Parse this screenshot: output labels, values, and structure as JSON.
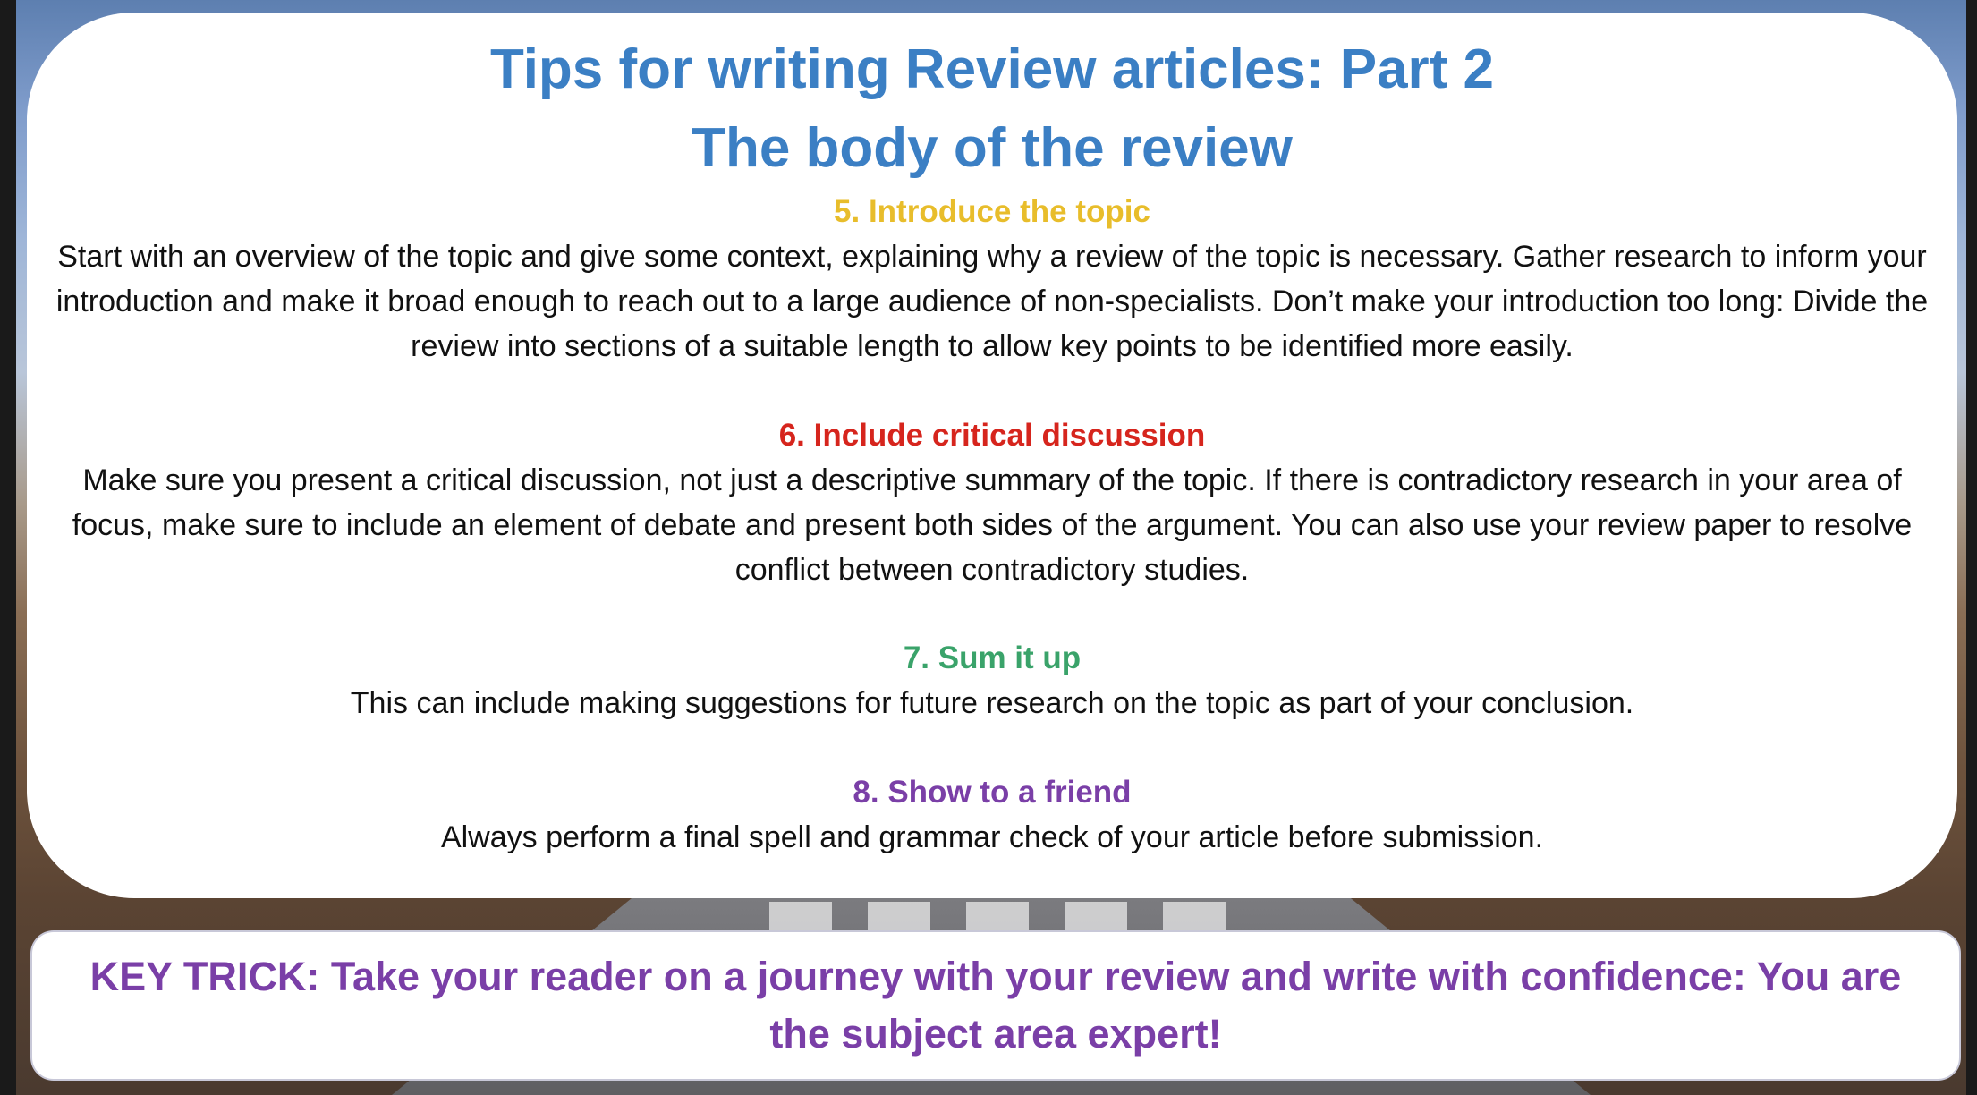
{
  "slide": {
    "title_line1": "Tips for writing Review articles: Part 2",
    "title_line2": "The body of the review",
    "sections": [
      {
        "heading": "5. Introduce the topic",
        "color": "#e8bd2b",
        "body": "Start with an overview of the topic and give some context, explaining why a review of the topic is necessary. Gather research to inform your introduction and make it broad enough to reach out to a large audience of non-specialists. Don’t make your introduction too long: Divide the review into sections of a suitable length to allow key points to be identified more easily."
      },
      {
        "heading": "6. Include critical discussion",
        "color": "#d6251d",
        "body": "Make sure you present a critical discussion, not just a descriptive summary of the topic. If there is contradictory research in your area of focus, make sure to include an element of debate and present both sides of the argument. You can also use your review paper to resolve conflict between contradictory studies."
      },
      {
        "heading": "7. Sum it up",
        "color": "#3aa36a",
        "body": "This can include making suggestions for future research on the topic as part of your conclusion."
      },
      {
        "heading": "8. Show to a friend",
        "color": "#7a3fa7",
        "body": "Always perform a final spell and grammar check of your article before submission."
      }
    ],
    "key_trick": "KEY TRICK: Take your reader on a journey with your review and write with confidence: You are the subject area expert!",
    "title_color": "#3b7fc4",
    "key_trick_color": "#7a3fa7"
  }
}
